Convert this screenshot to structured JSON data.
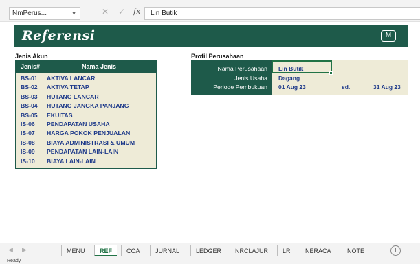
{
  "formula_bar": {
    "name_box": "NmPerus...",
    "formula": "Lin Butik",
    "cancel_icon": "x-icon",
    "enter_icon": "check-icon",
    "fx_label": "fx"
  },
  "banner": {
    "title": "Referensi",
    "button_label": "M"
  },
  "jenis_akun": {
    "title": "Jenis Akun",
    "headers": [
      "Jenis#",
      "Nama Jenis"
    ],
    "rows": [
      [
        "BS-01",
        "AKTIVA LANCAR"
      ],
      [
        "BS-02",
        "AKTIVA TETAP"
      ],
      [
        "BS-03",
        "HUTANG LANCAR"
      ],
      [
        "BS-04",
        "HUTANG JANGKA PANJANG"
      ],
      [
        "BS-05",
        "EKUITAS"
      ],
      [
        "IS-06",
        "PENDAPATAN USAHA"
      ],
      [
        "IS-07",
        "HARGA POKOK PENJUALAN"
      ],
      [
        "IS-08",
        "BIAYA ADMINISTRASI & UMUM"
      ],
      [
        "IS-09",
        "PENDAPATAN LAIN-LAIN"
      ],
      [
        "IS-10",
        "BIAYA LAIN-LAIN"
      ]
    ]
  },
  "profil": {
    "title": "Profil Perusahaan",
    "labels": [
      "Nama Perusahaan",
      "Jenis Usaha",
      "Periode Pembukuan"
    ],
    "nama_perusahaan": "Lin Butik",
    "jenis_usaha": "Dagang",
    "periode_start": "01 Aug 23",
    "periode_sep": "sd.",
    "periode_end": "31 Aug 23"
  },
  "tabs": [
    "MENU",
    "REF",
    "COA",
    "JURNAL",
    "LEDGER",
    "NRCLAJUR",
    "LR",
    "NERACA",
    "NOTE"
  ],
  "active_tab": "REF",
  "status": "Ready",
  "colors": {
    "header_green": "#1e5a4a",
    "cell_bg": "#eeebd7",
    "value_text": "#1e3a8a",
    "excel_green": "#217346"
  }
}
